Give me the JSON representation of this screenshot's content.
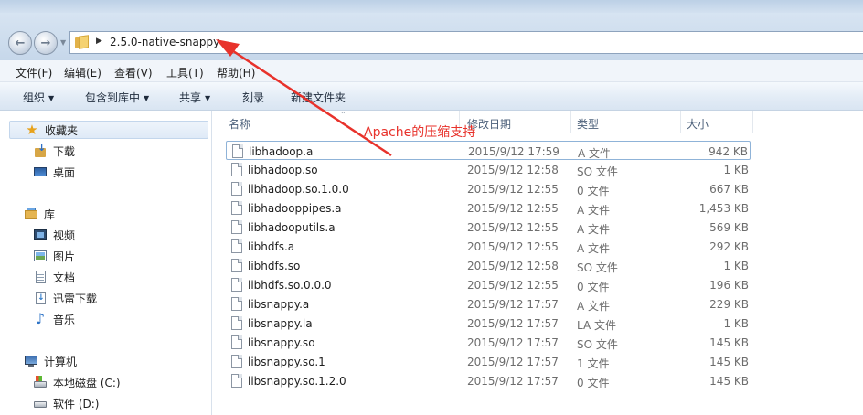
{
  "address": {
    "path": "2.5.0-native-snappy"
  },
  "menu": [
    "文件(F)",
    "编辑(E)",
    "查看(V)",
    "工具(T)",
    "帮助(H)"
  ],
  "commands": {
    "organize": "组织",
    "include_library": "包含到库中",
    "share": "共享",
    "burn": "刻录",
    "new_folder": "新建文件夹"
  },
  "nav": {
    "favorites": "收藏夹",
    "favorites_items": [
      "下载",
      "桌面"
    ],
    "libraries": "库",
    "library_items": [
      "视频",
      "图片",
      "文档",
      "迅雷下载",
      "音乐"
    ],
    "computer": "计算机",
    "computer_items": [
      "本地磁盘 (C:)",
      "软件 (D:)"
    ]
  },
  "columns": {
    "name": "名称",
    "date": "修改日期",
    "type": "类型",
    "size": "大小"
  },
  "files": [
    {
      "name": "libhadoop.a",
      "date": "2015/9/12 17:59",
      "type": "A 文件",
      "size": "942 KB"
    },
    {
      "name": "libhadoop.so",
      "date": "2015/9/12 12:58",
      "type": "SO 文件",
      "size": "1 KB"
    },
    {
      "name": "libhadoop.so.1.0.0",
      "date": "2015/9/12 12:55",
      "type": "0 文件",
      "size": "667 KB"
    },
    {
      "name": "libhadooppipes.a",
      "date": "2015/9/12 12:55",
      "type": "A 文件",
      "size": "1,453 KB"
    },
    {
      "name": "libhadooputils.a",
      "date": "2015/9/12 12:55",
      "type": "A 文件",
      "size": "569 KB"
    },
    {
      "name": "libhdfs.a",
      "date": "2015/9/12 12:55",
      "type": "A 文件",
      "size": "292 KB"
    },
    {
      "name": "libhdfs.so",
      "date": "2015/9/12 12:58",
      "type": "SO 文件",
      "size": "1 KB"
    },
    {
      "name": "libhdfs.so.0.0.0",
      "date": "2015/9/12 12:55",
      "type": "0 文件",
      "size": "196 KB"
    },
    {
      "name": "libsnappy.a",
      "date": "2015/9/12 17:57",
      "type": "A 文件",
      "size": "229 KB"
    },
    {
      "name": "libsnappy.la",
      "date": "2015/9/12 17:57",
      "type": "LA 文件",
      "size": "1 KB"
    },
    {
      "name": "libsnappy.so",
      "date": "2015/9/12 17:57",
      "type": "SO 文件",
      "size": "145 KB"
    },
    {
      "name": "libsnappy.so.1",
      "date": "2015/9/12 17:57",
      "type": "1 文件",
      "size": "145 KB"
    },
    {
      "name": "libsnappy.so.1.2.0",
      "date": "2015/9/12 17:57",
      "type": "0 文件",
      "size": "145 KB"
    }
  ],
  "annotation": {
    "text": "Apache的压缩支持",
    "color": "#e8322b"
  }
}
